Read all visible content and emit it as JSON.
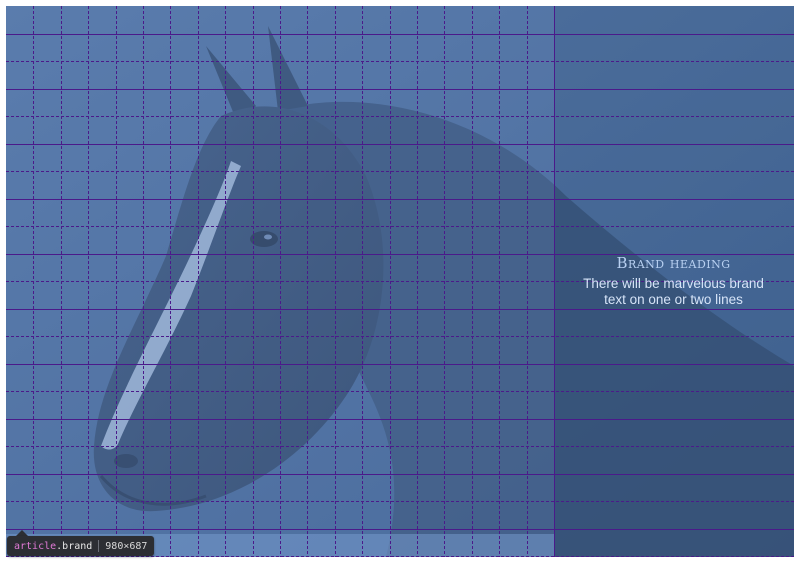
{
  "element": {
    "tag": "article",
    "class": ".brand",
    "dimensions": "980×687"
  },
  "brand": {
    "heading": "Brand heading",
    "body_line1": "There will be marvelous brand",
    "body_line2": "text on one or two lines"
  },
  "image": {
    "subject": "horse-head"
  },
  "colors": {
    "overlay": "#6f96d2",
    "grid_line": "#4b1a8a",
    "tooltip_bg": "#2c2e33",
    "tag_color": "#e07ad6"
  }
}
